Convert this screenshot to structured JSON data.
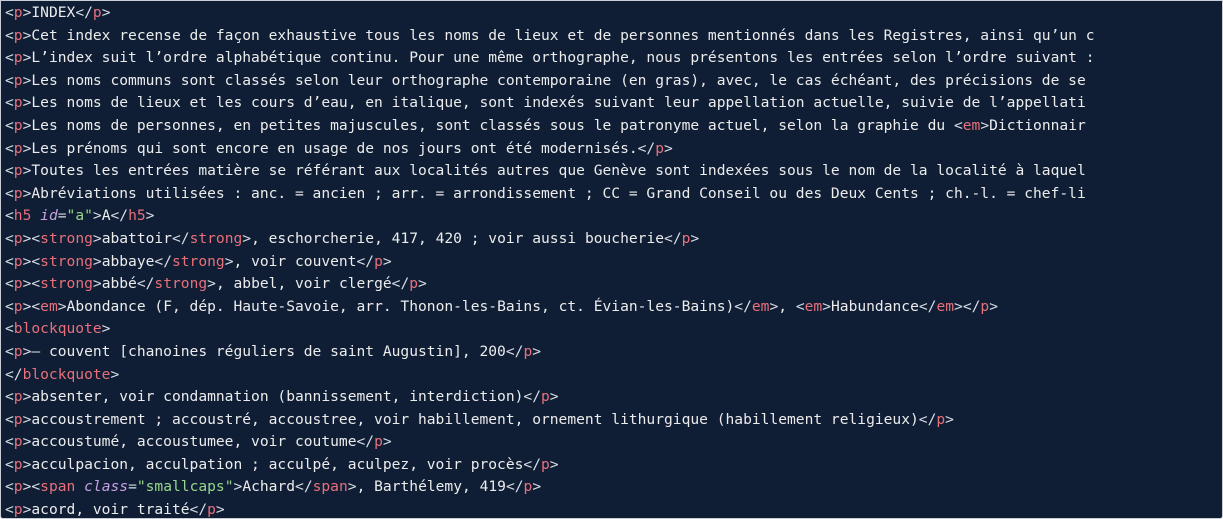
{
  "colors": {
    "background": "#0f1e35",
    "tag": "#e8707a",
    "attribute": "#c6a0e0",
    "attribute_value": "#98d68a",
    "text": "#ececec"
  },
  "editor": {
    "lines": [
      [
        [
          "b",
          "<"
        ],
        [
          "t",
          "p"
        ],
        [
          "b",
          ">"
        ],
        [
          "x",
          "INDEX"
        ],
        [
          "b",
          "</"
        ],
        [
          "t",
          "p"
        ],
        [
          "b",
          ">"
        ]
      ],
      [
        [
          "b",
          "<"
        ],
        [
          "t",
          "p"
        ],
        [
          "b",
          ">"
        ],
        [
          "x",
          "Cet index recense de façon exhaustive tous les noms de lieux et de personnes mentionnés dans les Registres, ainsi qu’un c"
        ]
      ],
      [
        [
          "b",
          "<"
        ],
        [
          "t",
          "p"
        ],
        [
          "b",
          ">"
        ],
        [
          "x",
          "L’index suit l’ordre alphabétique continu. Pour une même orthographe, nous présentons les entrées selon l’ordre suivant :"
        ]
      ],
      [
        [
          "b",
          "<"
        ],
        [
          "t",
          "p"
        ],
        [
          "b",
          ">"
        ],
        [
          "x",
          "Les noms communs sont classés selon leur orthographe contemporaine (en gras), avec, le cas échéant, des précisions de se"
        ]
      ],
      [
        [
          "b",
          "<"
        ],
        [
          "t",
          "p"
        ],
        [
          "b",
          ">"
        ],
        [
          "x",
          "Les noms de lieux et les cours d’eau, en italique, sont indexés suivant leur appellation actuelle, suivie de l’appellati"
        ]
      ],
      [
        [
          "b",
          "<"
        ],
        [
          "t",
          "p"
        ],
        [
          "b",
          ">"
        ],
        [
          "x",
          "Les noms de personnes, en petites majuscules, sont classés sous le patronyme actuel, selon la graphie du "
        ],
        [
          "b",
          "<"
        ],
        [
          "t",
          "em"
        ],
        [
          "b",
          ">"
        ],
        [
          "x",
          "Dictionnair"
        ]
      ],
      [
        [
          "b",
          "<"
        ],
        [
          "t",
          "p"
        ],
        [
          "b",
          ">"
        ],
        [
          "x",
          "Les prénoms qui sont encore en usage de nos jours ont été modernisés."
        ],
        [
          "b",
          "</"
        ],
        [
          "t",
          "p"
        ],
        [
          "b",
          ">"
        ]
      ],
      [
        [
          "b",
          "<"
        ],
        [
          "t",
          "p"
        ],
        [
          "b",
          ">"
        ],
        [
          "x",
          "Toutes les entrées matière se référant aux localités autres que Genève sont indexées sous le nom de la localité à laquel"
        ]
      ],
      [
        [
          "b",
          "<"
        ],
        [
          "t",
          "p"
        ],
        [
          "b",
          ">"
        ],
        [
          "x",
          "Abréviations utilisées : anc. = ancien ; arr. = arrondissement ; CC = Grand Conseil ou des Deux Cents ; ch.-l. = chef-li"
        ]
      ],
      [
        [
          "b",
          "<"
        ],
        [
          "t",
          "h5"
        ],
        [
          "x",
          " "
        ],
        [
          "a",
          "id"
        ],
        [
          "b",
          "="
        ],
        [
          "v",
          "\"a\""
        ],
        [
          "b",
          ">"
        ],
        [
          "x",
          "A"
        ],
        [
          "b",
          "</"
        ],
        [
          "t",
          "h5"
        ],
        [
          "b",
          ">"
        ]
      ],
      [
        [
          "b",
          "<"
        ],
        [
          "t",
          "p"
        ],
        [
          "b",
          "><"
        ],
        [
          "t",
          "strong"
        ],
        [
          "b",
          ">"
        ],
        [
          "x",
          "abattoir"
        ],
        [
          "b",
          "</"
        ],
        [
          "t",
          "strong"
        ],
        [
          "b",
          ">"
        ],
        [
          "x",
          ", eschorcherie, 417, 420 ; voir aussi boucherie"
        ],
        [
          "b",
          "</"
        ],
        [
          "t",
          "p"
        ],
        [
          "b",
          ">"
        ]
      ],
      [
        [
          "b",
          "<"
        ],
        [
          "t",
          "p"
        ],
        [
          "b",
          "><"
        ],
        [
          "t",
          "strong"
        ],
        [
          "b",
          ">"
        ],
        [
          "x",
          "abbaye"
        ],
        [
          "b",
          "</"
        ],
        [
          "t",
          "strong"
        ],
        [
          "b",
          ">"
        ],
        [
          "x",
          ", voir couvent"
        ],
        [
          "b",
          "</"
        ],
        [
          "t",
          "p"
        ],
        [
          "b",
          ">"
        ]
      ],
      [
        [
          "b",
          "<"
        ],
        [
          "t",
          "p"
        ],
        [
          "b",
          "><"
        ],
        [
          "t",
          "strong"
        ],
        [
          "b",
          ">"
        ],
        [
          "x",
          "abbé"
        ],
        [
          "b",
          "</"
        ],
        [
          "t",
          "strong"
        ],
        [
          "b",
          ">"
        ],
        [
          "x",
          ", abbel, voir clergé"
        ],
        [
          "b",
          "</"
        ],
        [
          "t",
          "p"
        ],
        [
          "b",
          ">"
        ]
      ],
      [
        [
          "b",
          "<"
        ],
        [
          "t",
          "p"
        ],
        [
          "b",
          "><"
        ],
        [
          "t",
          "em"
        ],
        [
          "b",
          ">"
        ],
        [
          "x",
          "Abondance (F, dép. Haute-Savoie, arr. Thonon-les-Bains, ct. Évian-les-Bains)"
        ],
        [
          "b",
          "</"
        ],
        [
          "t",
          "em"
        ],
        [
          "b",
          ">"
        ],
        [
          "x",
          ", "
        ],
        [
          "b",
          "<"
        ],
        [
          "t",
          "em"
        ],
        [
          "b",
          ">"
        ],
        [
          "x",
          "Habundance"
        ],
        [
          "b",
          "</"
        ],
        [
          "t",
          "em"
        ],
        [
          "b",
          "></"
        ],
        [
          "t",
          "p"
        ],
        [
          "b",
          ">"
        ]
      ],
      [
        [
          "b",
          "<"
        ],
        [
          "t",
          "blockquote"
        ],
        [
          "b",
          ">"
        ]
      ],
      [
        [
          "b",
          "<"
        ],
        [
          "t",
          "p"
        ],
        [
          "b",
          ">"
        ],
        [
          "x",
          "— couvent [chanoines réguliers de saint Augustin], 200"
        ],
        [
          "b",
          "</"
        ],
        [
          "t",
          "p"
        ],
        [
          "b",
          ">"
        ]
      ],
      [
        [
          "b",
          "</"
        ],
        [
          "t",
          "blockquote"
        ],
        [
          "b",
          ">"
        ]
      ],
      [
        [
          "b",
          "<"
        ],
        [
          "t",
          "p"
        ],
        [
          "b",
          ">"
        ],
        [
          "x",
          "absenter, voir condamnation (bannissement, interdiction)"
        ],
        [
          "b",
          "</"
        ],
        [
          "t",
          "p"
        ],
        [
          "b",
          ">"
        ]
      ],
      [
        [
          "b",
          "<"
        ],
        [
          "t",
          "p"
        ],
        [
          "b",
          ">"
        ],
        [
          "x",
          "accoustrement ; accoustré, accoustree, voir habillement, ornement lithurgique (habillement religieux)"
        ],
        [
          "b",
          "</"
        ],
        [
          "t",
          "p"
        ],
        [
          "b",
          ">"
        ]
      ],
      [
        [
          "b",
          "<"
        ],
        [
          "t",
          "p"
        ],
        [
          "b",
          ">"
        ],
        [
          "x",
          "accoustumé, accoustumee, voir coutume"
        ],
        [
          "b",
          "</"
        ],
        [
          "t",
          "p"
        ],
        [
          "b",
          ">"
        ]
      ],
      [
        [
          "b",
          "<"
        ],
        [
          "t",
          "p"
        ],
        [
          "b",
          ">"
        ],
        [
          "x",
          "acculpacion, acculpation ; acculpé, aculpez, voir procès"
        ],
        [
          "b",
          "</"
        ],
        [
          "t",
          "p"
        ],
        [
          "b",
          ">"
        ]
      ],
      [
        [
          "b",
          "<"
        ],
        [
          "t",
          "p"
        ],
        [
          "b",
          "><"
        ],
        [
          "t",
          "span"
        ],
        [
          "x",
          " "
        ],
        [
          "a",
          "class"
        ],
        [
          "b",
          "="
        ],
        [
          "v",
          "\"smallcaps\""
        ],
        [
          "b",
          ">"
        ],
        [
          "x",
          "Achard"
        ],
        [
          "b",
          "</"
        ],
        [
          "t",
          "span"
        ],
        [
          "b",
          ">"
        ],
        [
          "x",
          ", Barthélemy, 419"
        ],
        [
          "b",
          "</"
        ],
        [
          "t",
          "p"
        ],
        [
          "b",
          ">"
        ]
      ],
      [
        [
          "b",
          "<"
        ],
        [
          "t",
          "p"
        ],
        [
          "b",
          ">"
        ],
        [
          "x",
          "acord, voir traité"
        ],
        [
          "b",
          "</"
        ],
        [
          "t",
          "p"
        ],
        [
          "b",
          ">"
        ]
      ]
    ]
  }
}
